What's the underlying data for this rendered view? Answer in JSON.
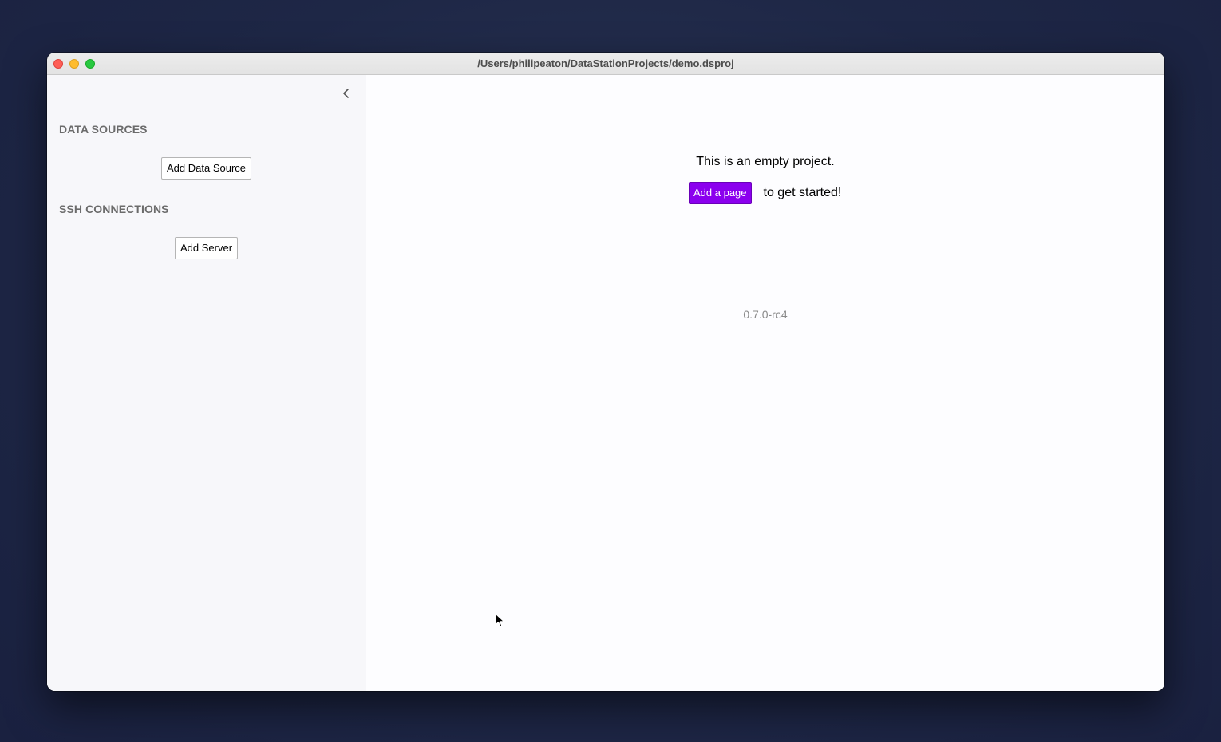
{
  "window": {
    "title": "/Users/philipeaton/DataStationProjects/demo.dsproj"
  },
  "sidebar": {
    "collapse_icon": "chevron-left-icon",
    "data_sources": {
      "heading": "DATA SOURCES",
      "add_button": "Add Data Source"
    },
    "ssh_connections": {
      "heading": "SSH CONNECTIONS",
      "add_button": "Add Server"
    }
  },
  "main": {
    "empty_message": "This is an empty project.",
    "add_page_button": "Add a page",
    "get_started_text": "to get started!",
    "version": "0.7.0-rc4"
  },
  "colors": {
    "accent": "#8b00ee",
    "traffic_close": "#fe5f57",
    "traffic_minimize": "#febc2e",
    "traffic_maximize": "#28c840"
  }
}
